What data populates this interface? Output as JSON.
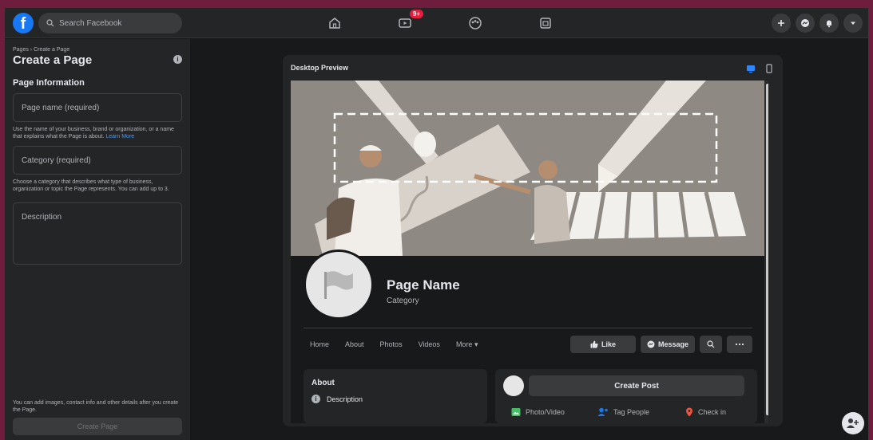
{
  "app": "Facebook",
  "header": {
    "logo": "f",
    "search_placeholder": "Search Facebook",
    "nav": [
      {
        "name": "home-icon"
      },
      {
        "name": "watch-icon",
        "badge": "9+"
      },
      {
        "name": "groups-icon"
      },
      {
        "name": "gaming-icon"
      }
    ],
    "actions": [
      "plus-icon",
      "messenger-icon",
      "notifications-icon",
      "account-menu-icon"
    ]
  },
  "left_panel": {
    "breadcrumb": "Pages › Create a Page",
    "title": "Create a Page",
    "section": "Page Information",
    "page_name_placeholder": "Page name (required)",
    "page_name_help": "Use the name of your business, brand or organization, or a name that explains what the Page is about.",
    "learn_more": "Learn More",
    "category_placeholder": "Category (required)",
    "category_help": "Choose a category that describes what type of business, organization or topic the Page represents. You can add up to 3.",
    "description_placeholder": "Description",
    "bottom_help": "You can add images, contact info and other details after you create the Page.",
    "create_button": "Create Page"
  },
  "preview": {
    "header": "Desktop Preview",
    "page_name": "Page Name",
    "category": "Category",
    "tabs": [
      "Home",
      "About",
      "Photos",
      "Videos",
      "More ▾"
    ],
    "like_label": "Like",
    "message_label": "Message",
    "about_title": "About",
    "about_description": "Description",
    "create_post": "Create Post",
    "photo_video": "Photo/Video",
    "tag_people": "Tag People",
    "check_in": "Check in"
  },
  "colors": {
    "brand": "#1877f2",
    "background": "#18191a",
    "surface": "#242526",
    "outer_border": "#6e1e3c"
  }
}
